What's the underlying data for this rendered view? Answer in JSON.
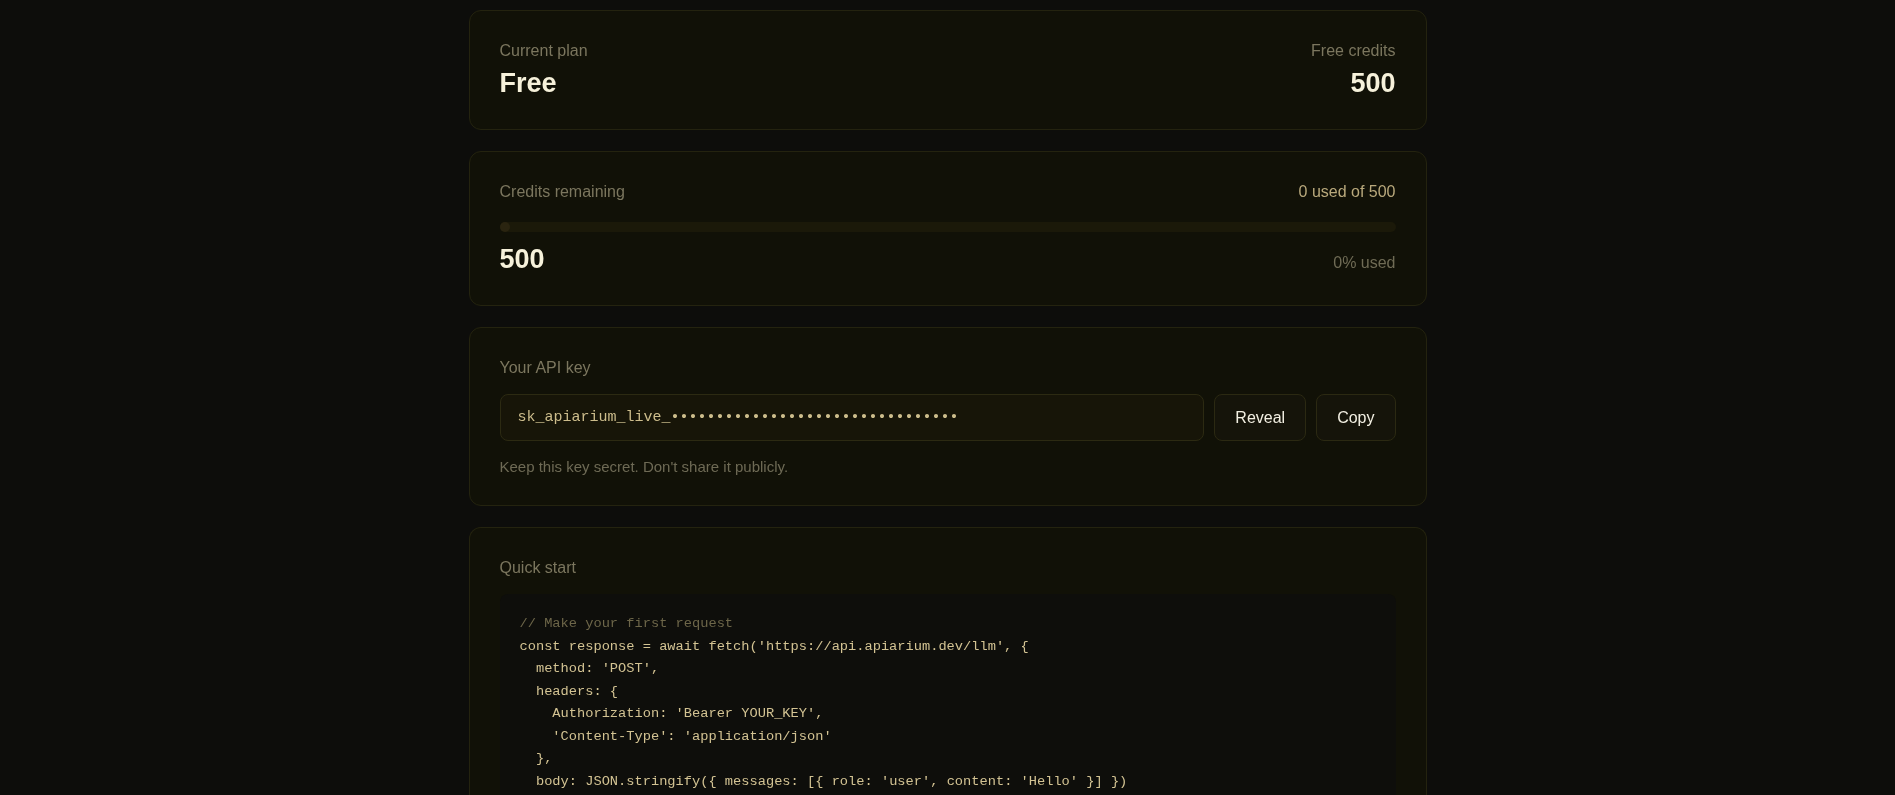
{
  "plan_card": {
    "label": "Current plan",
    "value": "Free",
    "credits_label": "Free credits",
    "credits_value": "500"
  },
  "usage_card": {
    "label": "Credits remaining",
    "usage_text": "0 used of 500",
    "level": 0,
    "remaining": "500",
    "percent_text": "0% used"
  },
  "api_key_card": {
    "label": "Your API key",
    "key_value": "sk_apiarium_live_••••••••••••••••••••••••••••••••",
    "buttons": [
      "Reveal",
      "Copy"
    ],
    "hint": "Keep this key secret. Don't share it publicly."
  },
  "quick_start_card": {
    "title": "Quick start",
    "code_lines": [
      {
        "kind": "comment",
        "text": "// Make your first request"
      },
      {
        "kind": "code",
        "text": "const response = await fetch('https://api.apiarium.dev/llm', {"
      },
      {
        "kind": "code",
        "text": "  method: 'POST',"
      },
      {
        "kind": "code",
        "text": "  headers: {"
      },
      {
        "kind": "code",
        "text": "    Authorization: 'Bearer YOUR_KEY',"
      },
      {
        "kind": "code",
        "text": "    'Content-Type': 'application/json'"
      },
      {
        "kind": "code",
        "text": "  },"
      },
      {
        "kind": "code",
        "text": "  body: JSON.stringify({ messages: [{ role: 'user', content: 'Hello' }] })"
      }
    ]
  }
}
